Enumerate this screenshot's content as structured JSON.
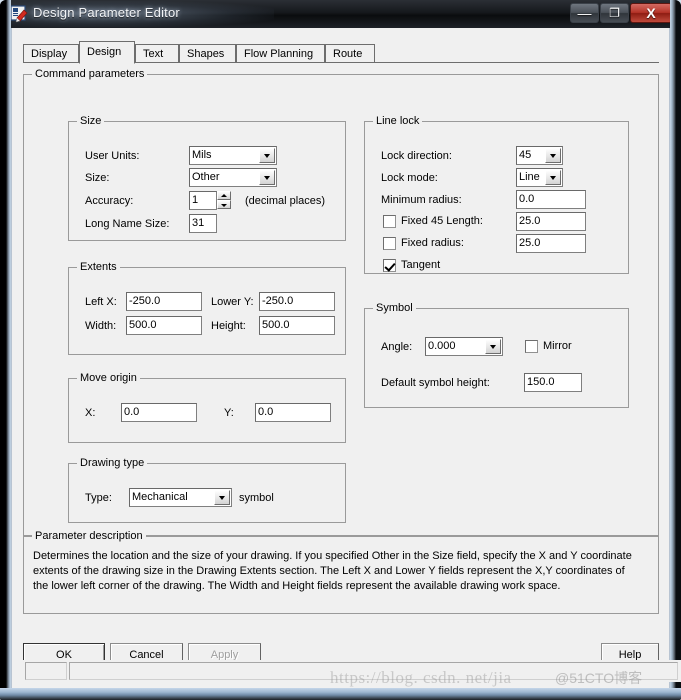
{
  "window": {
    "title": "Design Parameter Editor",
    "icon": "app-editor-icon",
    "controls": {
      "minimize": "—",
      "maximize": "❐",
      "close": "X"
    }
  },
  "tabs": [
    {
      "label": "Display",
      "selected": false
    },
    {
      "label": "Design",
      "selected": true
    },
    {
      "label": "Text",
      "selected": false
    },
    {
      "label": "Shapes",
      "selected": false
    },
    {
      "label": "Flow Planning",
      "selected": false
    },
    {
      "label": "Route",
      "selected": false
    }
  ],
  "command_parameters": {
    "legend": "Command parameters",
    "size": {
      "legend": "Size",
      "user_units_label": "User Units:",
      "user_units_value": "Mils",
      "size_label": "Size:",
      "size_value": "Other",
      "accuracy_label": "Accuracy:",
      "accuracy_value": "1",
      "accuracy_suffix": "(decimal places)",
      "long_name_size_label": "Long Name Size:",
      "long_name_size_value": "31"
    },
    "extents": {
      "legend": "Extents",
      "left_x_label": "Left X:",
      "left_x_value": "-250.0",
      "lower_y_label": "Lower Y:",
      "lower_y_value": "-250.0",
      "width_label": "Width:",
      "width_value": "500.0",
      "height_label": "Height:",
      "height_value": "500.0"
    },
    "move_origin": {
      "legend": "Move origin",
      "x_label": "X:",
      "x_value": "0.0",
      "y_label": "Y:",
      "y_value": "0.0"
    },
    "drawing_type": {
      "legend": "Drawing type",
      "type_label": "Type:",
      "type_value": "Mechanical",
      "type_suffix": "symbol"
    },
    "line_lock": {
      "legend": "Line lock",
      "lock_direction_label": "Lock direction:",
      "lock_direction_value": "45",
      "lock_mode_label": "Lock mode:",
      "lock_mode_value": "Line",
      "minimum_radius_label": "Minimum radius:",
      "minimum_radius_value": "0.0",
      "fixed_45_length_label": "Fixed 45 Length:",
      "fixed_45_length_value": "25.0",
      "fixed_45_length_checked": false,
      "fixed_radius_label": "Fixed radius:",
      "fixed_radius_value": "25.0",
      "fixed_radius_checked": false,
      "tangent_label": "Tangent",
      "tangent_checked": true
    },
    "symbol": {
      "legend": "Symbol",
      "angle_label": "Angle:",
      "angle_value": "0.000",
      "mirror_label": "Mirror",
      "mirror_checked": false,
      "default_symbol_height_label": "Default symbol height:",
      "default_symbol_height_value": "150.0"
    }
  },
  "parameter_description": {
    "legend": "Parameter description",
    "text": "Determines the location and the size of your drawing.  If you specified Other in the Size field, specify the X and Y coordinate extents of the drawing size in the Drawing Extents section. The Left X and Lower Y fields represent the X,Y coordinates of the lower left corner of the drawing.  The Width and Height fields represent the available drawing work space."
  },
  "buttons": {
    "ok": "OK",
    "cancel": "Cancel",
    "apply": "Apply",
    "help": "Help"
  },
  "statusbar": {
    "pane1": "",
    "pane2": ""
  },
  "watermark": {
    "url": "https://blog. csdn. net/jia",
    "tag": "@51CTO博客"
  },
  "colors": {
    "dialog_background": "#f0f0f0",
    "field_background": "#ffffff",
    "group_border": "#9a9a9a",
    "titlebar": "#15181c",
    "close_button": "#b43327"
  }
}
